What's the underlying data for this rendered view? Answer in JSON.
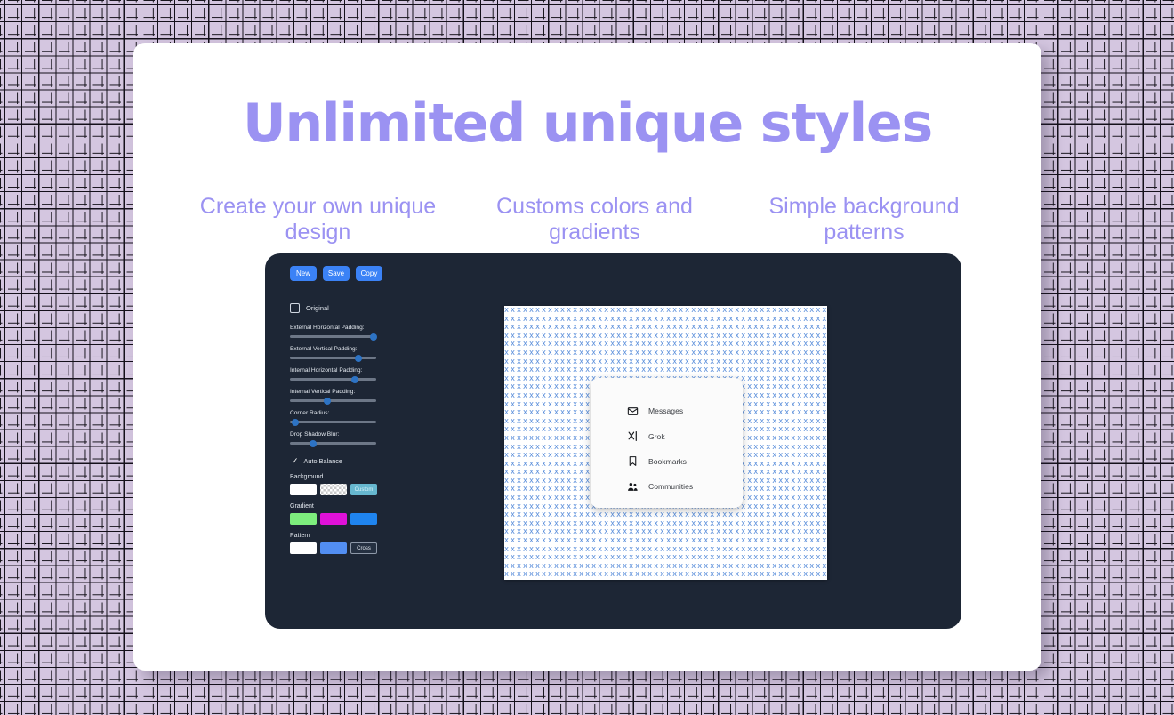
{
  "page": {
    "background_color": "#d4c6e0",
    "pattern_mark_color": "#14101a",
    "accent_color": "#9b92f2"
  },
  "hero": {
    "title": "Unlimited unique styles",
    "features": [
      "Create your own unique design",
      "Customs colors and gradients",
      "Simple background patterns"
    ]
  },
  "editor": {
    "panel_color": "#1d2635",
    "toolbar": {
      "new_label": "New",
      "save_label": "Save",
      "copy_label": "Copy",
      "button_color": "#3b82f6"
    },
    "original_checkbox": {
      "label": "Original",
      "checked": false
    },
    "sliders": [
      {
        "label": "External Horizontal Padding:",
        "value": 97
      },
      {
        "label": "External Vertical Padding:",
        "value": 79
      },
      {
        "label": "Internal Horizontal Padding:",
        "value": 75
      },
      {
        "label": "Internal Vertical Padding:",
        "value": 43
      },
      {
        "label": "Corner Radius:",
        "value": 6
      },
      {
        "label": "Drop Shadow Blur:",
        "value": 27
      }
    ],
    "auto_balance": {
      "label": "Auto Balance",
      "check_glyph": "✓",
      "checked": true
    },
    "background_section": {
      "title": "Background",
      "swatches": [
        {
          "name": "white",
          "label": "",
          "color": "#ffffff"
        },
        {
          "name": "transparent-checker",
          "label": "",
          "color": "#cccccc"
        },
        {
          "name": "custom",
          "label": "Custom",
          "color": "#66b7cf"
        }
      ]
    },
    "gradient_section": {
      "title": "Gradient",
      "swatches": [
        {
          "name": "green",
          "label": "",
          "color": "#7dee7d"
        },
        {
          "name": "magenta",
          "label": "",
          "color": "#e011d8"
        },
        {
          "name": "blue",
          "label": "",
          "color": "#1f84ef"
        }
      ]
    },
    "pattern_section": {
      "title": "Pattern",
      "swatches": [
        {
          "name": "white",
          "label": "",
          "color": "#ffffff"
        },
        {
          "name": "light-blue",
          "label": "",
          "color": "#528ef2"
        },
        {
          "name": "cross",
          "label": "Cross",
          "color": "#253041"
        }
      ]
    }
  },
  "preview": {
    "pattern_glyph": "x",
    "pattern_color": "#5b8fdb",
    "surface_color": "#ffffff",
    "menu_card": {
      "background": "#fbfbfb",
      "items": [
        {
          "icon": "envelope-icon",
          "label": "Messages"
        },
        {
          "icon": "grok-icon",
          "label": "Grok"
        },
        {
          "icon": "bookmark-icon",
          "label": "Bookmarks"
        },
        {
          "icon": "communities-icon",
          "label": "Communities"
        }
      ]
    }
  }
}
